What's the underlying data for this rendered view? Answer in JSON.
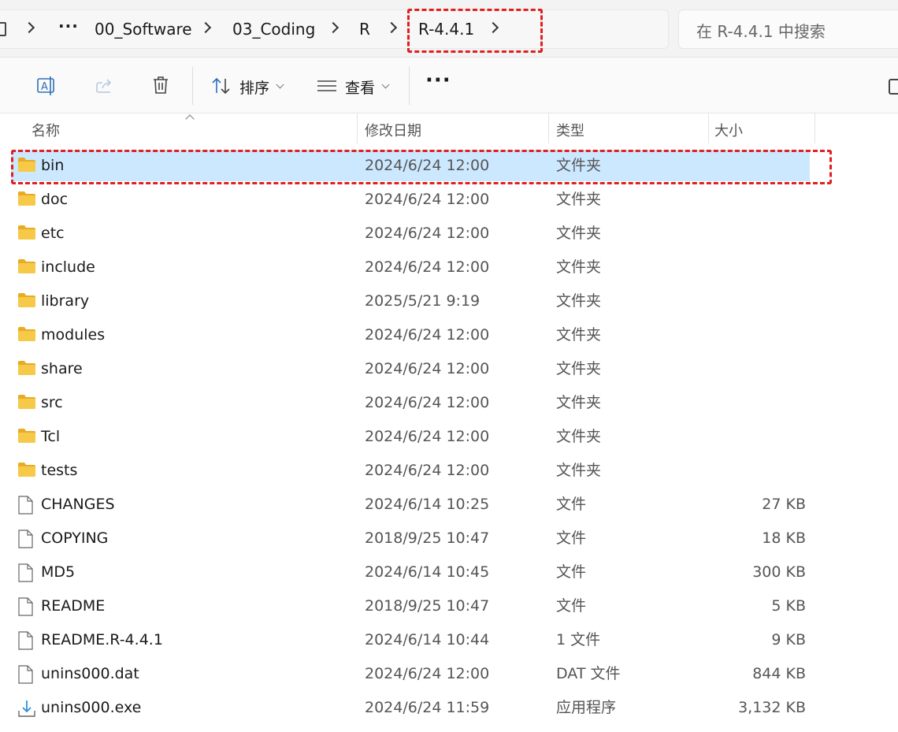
{
  "window": {
    "breadcrumb": [
      "00_Software",
      "03_Coding",
      "R",
      "R-4.4.1"
    ],
    "ellipsis": "···",
    "search_placeholder": "在 R-4.4.1 中搜索"
  },
  "toolbar": {
    "sort_label": "排序",
    "view_label": "查看",
    "more_label": "···"
  },
  "columns": {
    "name": "名称",
    "date": "修改日期",
    "type": "类型",
    "size": "大小"
  },
  "files": [
    {
      "name": "bin",
      "date": "2024/6/24 12:00",
      "type": "文件夹",
      "size": "",
      "icon": "folder-icon",
      "selected": true
    },
    {
      "name": "doc",
      "date": "2024/6/24 12:00",
      "type": "文件夹",
      "size": "",
      "icon": "folder-icon"
    },
    {
      "name": "etc",
      "date": "2024/6/24 12:00",
      "type": "文件夹",
      "size": "",
      "icon": "folder-icon"
    },
    {
      "name": "include",
      "date": "2024/6/24 12:00",
      "type": "文件夹",
      "size": "",
      "icon": "folder-icon"
    },
    {
      "name": "library",
      "date": "2025/5/21 9:19",
      "type": "文件夹",
      "size": "",
      "icon": "folder-icon"
    },
    {
      "name": "modules",
      "date": "2024/6/24 12:00",
      "type": "文件夹",
      "size": "",
      "icon": "folder-icon"
    },
    {
      "name": "share",
      "date": "2024/6/24 12:00",
      "type": "文件夹",
      "size": "",
      "icon": "folder-icon"
    },
    {
      "name": "src",
      "date": "2024/6/24 12:00",
      "type": "文件夹",
      "size": "",
      "icon": "folder-icon"
    },
    {
      "name": "Tcl",
      "date": "2024/6/24 12:00",
      "type": "文件夹",
      "size": "",
      "icon": "folder-icon"
    },
    {
      "name": "tests",
      "date": "2024/6/24 12:00",
      "type": "文件夹",
      "size": "",
      "icon": "folder-icon"
    },
    {
      "name": "CHANGES",
      "date": "2024/6/14 10:25",
      "type": "文件",
      "size": "27 KB",
      "icon": "file-icon"
    },
    {
      "name": "COPYING",
      "date": "2018/9/25 10:47",
      "type": "文件",
      "size": "18 KB",
      "icon": "file-icon"
    },
    {
      "name": "MD5",
      "date": "2024/6/14 10:45",
      "type": "文件",
      "size": "300 KB",
      "icon": "file-icon"
    },
    {
      "name": "README",
      "date": "2018/9/25 10:47",
      "type": "文件",
      "size": "5 KB",
      "icon": "file-icon"
    },
    {
      "name": "README.R-4.4.1",
      "date": "2024/6/14 10:44",
      "type": "1 文件",
      "size": "9 KB",
      "icon": "file-icon"
    },
    {
      "name": "unins000.dat",
      "date": "2024/6/24 12:00",
      "type": "DAT 文件",
      "size": "844 KB",
      "icon": "file-icon"
    },
    {
      "name": "unins000.exe",
      "date": "2024/6/24 11:59",
      "type": "应用程序",
      "size": "3,132 KB",
      "icon": "installer-icon"
    }
  ],
  "colors": {
    "selection": "#cce8ff",
    "highlight": "#e02020",
    "folder": "#f5c542"
  }
}
